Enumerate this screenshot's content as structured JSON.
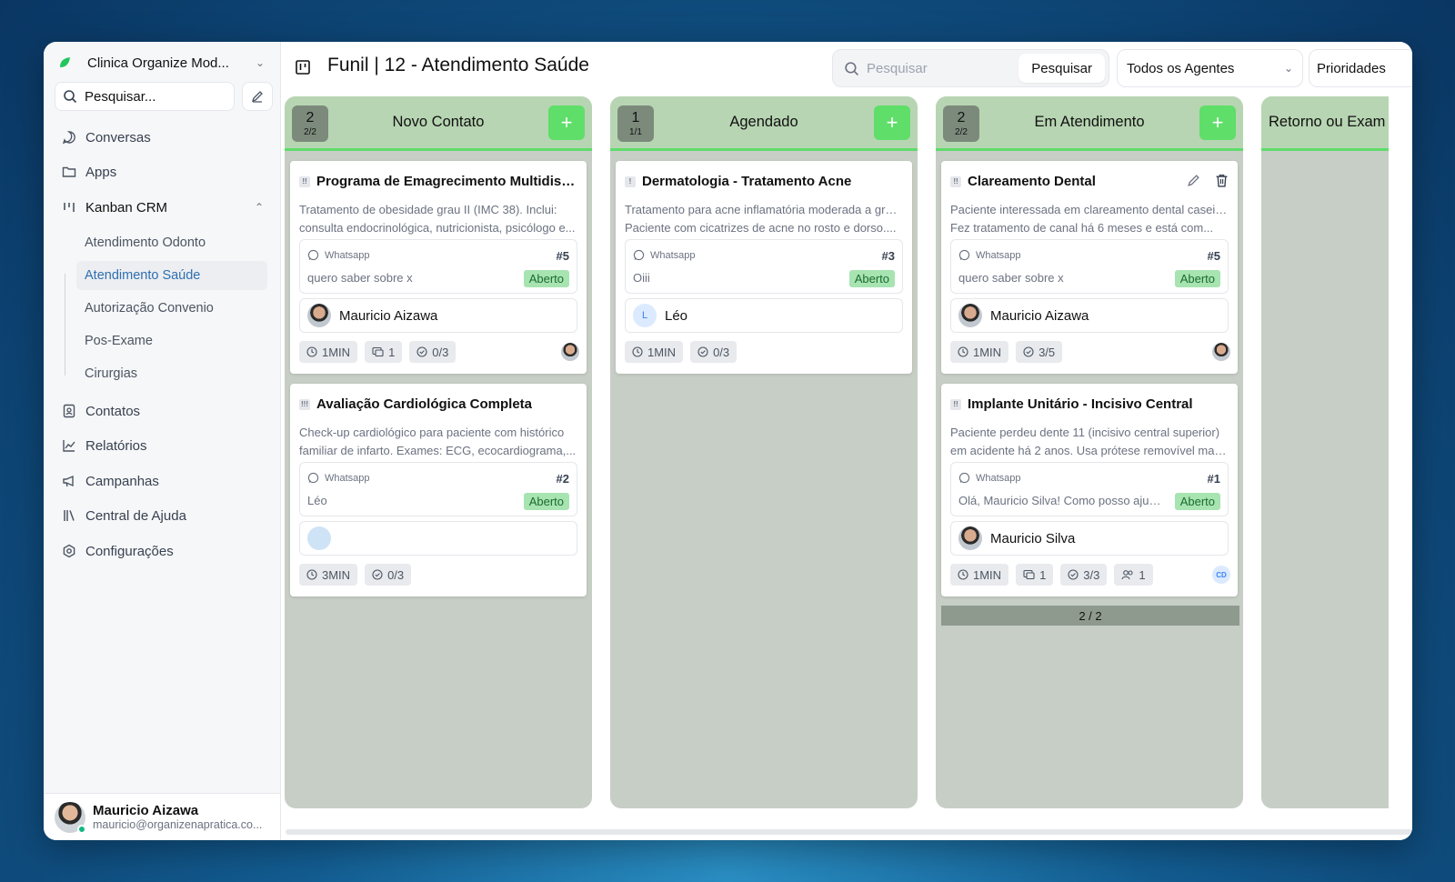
{
  "sidebar": {
    "org_name": "Clinica Organize Mod...",
    "search_placeholder": "Pesquisar...",
    "nav": {
      "conversas": "Conversas",
      "apps": "Apps",
      "kanban": "Kanban CRM",
      "contatos": "Contatos",
      "relatorios": "Relatórios",
      "campanhas": "Campanhas",
      "ajuda": "Central de Ajuda",
      "config": "Configurações"
    },
    "kanban_items": [
      "Atendimento Odonto",
      "Atendimento Saúde",
      "Autorização Convenio",
      "Pos-Exame",
      "Cirurgias"
    ],
    "user": {
      "name": "Mauricio Aizawa",
      "email": "mauricio@organizenapratica.co..."
    }
  },
  "header": {
    "title": "Funil | 12 - Atendimento Saúde",
    "search_placeholder": "Pesquisar",
    "search_button": "Pesquisar",
    "agents_select": "Todos os Agentes",
    "priorities_select": "Prioridades"
  },
  "columns": [
    {
      "title": "Novo Contato",
      "count": "2",
      "sub": "2/2",
      "cards": [
        {
          "title": "Programa de Emagrecimento Multidisci...",
          "desc1": "Tratamento de obesidade grau II (IMC 38). Inclui:",
          "desc2": "consulta endocrinológica, nutricionista, psicólogo e...",
          "channel": "Whatsapp",
          "number": "#5",
          "message": "quero saber sobre x",
          "status": "Aberto",
          "contact": "Mauricio Aizawa",
          "time": "1MIN",
          "attachments": "1",
          "tasks": "0/3"
        },
        {
          "title": "Avaliação Cardiológica Completa",
          "desc1": "Check-up cardiológico para paciente com histórico",
          "desc2": "familiar de infarto. Exames: ECG, ecocardiograma,...",
          "channel": "Whatsapp",
          "number": "#2",
          "message": "Léo",
          "status": "Aberto",
          "time": "3MIN",
          "tasks": "0/3"
        }
      ]
    },
    {
      "title": "Agendado",
      "count": "1",
      "sub": "1/1",
      "cards": [
        {
          "title": "Dermatologia - Tratamento Acne",
          "desc1": "Tratamento para acne inflamatória moderada a grave.",
          "desc2": "Paciente com cicatrizes de acne no rosto e dorso....",
          "channel": "Whatsapp",
          "number": "#3",
          "message": "Oiii",
          "status": "Aberto",
          "contact": "Léo",
          "contact_initial": "L",
          "time": "1MIN",
          "tasks": "0/3"
        }
      ]
    },
    {
      "title": "Em Atendimento",
      "count": "2",
      "sub": "2/2",
      "pager": "2 / 2",
      "cards": [
        {
          "title": "Clareamento Dental",
          "desc1": "Paciente interessada em clareamento dental caseiro.",
          "desc2": "Fez tratamento de canal há 6 meses e está com...",
          "channel": "Whatsapp",
          "number": "#5",
          "message": "quero saber sobre x",
          "status": "Aberto",
          "contact": "Mauricio Aizawa",
          "time": "1MIN",
          "tasks": "3/5"
        },
        {
          "title": "Implante Unitário - Incisivo Central",
          "desc1": "Paciente perdeu dente 11 (incisivo central superior)",
          "desc2": "em acidente há 2 anos. Usa prótese removível mas...",
          "channel": "Whatsapp",
          "number": "#1",
          "message": "Olá, Mauricio Silva! Como posso ajudar...",
          "status": "Aberto",
          "contact": "Mauricio Silva",
          "time": "1MIN",
          "attachments": "1",
          "tasks": "3/3",
          "people": "1",
          "assignee_initials": "CD"
        }
      ]
    },
    {
      "title": "Retorno ou Exam"
    }
  ],
  "colors": {
    "accent": "#2f6fb0",
    "column_bg": "#c7cec6",
    "column_header": "#b7d5b2",
    "add_button": "#5fde69",
    "status_badge": "#a7e4b1"
  }
}
